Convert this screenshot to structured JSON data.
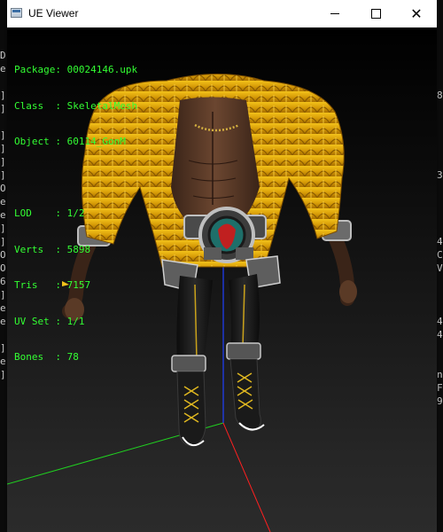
{
  "window": {
    "title": "UE Viewer"
  },
  "controls": {
    "minimize_icon": "minimize-icon",
    "maximize_icon": "maximize-icon",
    "close_icon": "close-icon"
  },
  "overlay": {
    "package_label": "Package:",
    "package_value": "00024146.upk",
    "class_label": "Class  :",
    "class_value": "SkeletalMesh",
    "object_label": "Object :",
    "object_value": "60114_GonM",
    "lod_label": "LOD    :",
    "lod_value": "1/2",
    "verts_label": "Verts  :",
    "verts_value": "5898",
    "tris_label": "Tris   :",
    "tris_value": "7157",
    "uvset_label": "UV Set :",
    "uvset_value": "1/1",
    "bones_label": "Bones  :",
    "bones_value": "78"
  },
  "background_console": {
    "left_chars": [
      "D",
      "e",
      "",
      "]",
      "]",
      "",
      "]",
      "]",
      "]",
      "]",
      "O",
      "e",
      "e",
      "]",
      "]",
      "O",
      "O",
      "6",
      "]",
      "e",
      "e",
      "",
      "]",
      "e",
      "]"
    ],
    "right_chars": [
      "",
      "",
      "",
      "8",
      "",
      "",
      "",
      "",
      "",
      "3",
      "",
      "",
      "",
      "",
      "4",
      "C",
      "V",
      "",
      "",
      "",
      "4",
      "4",
      "",
      "",
      "n",
      "F",
      "9",
      "",
      ""
    ]
  },
  "colors": {
    "overlay_text": "#33ff33",
    "axis_x": "#ff2020",
    "axis_y": "#20d020",
    "axis_z": "#2040ff",
    "fur": "#e0a800"
  }
}
